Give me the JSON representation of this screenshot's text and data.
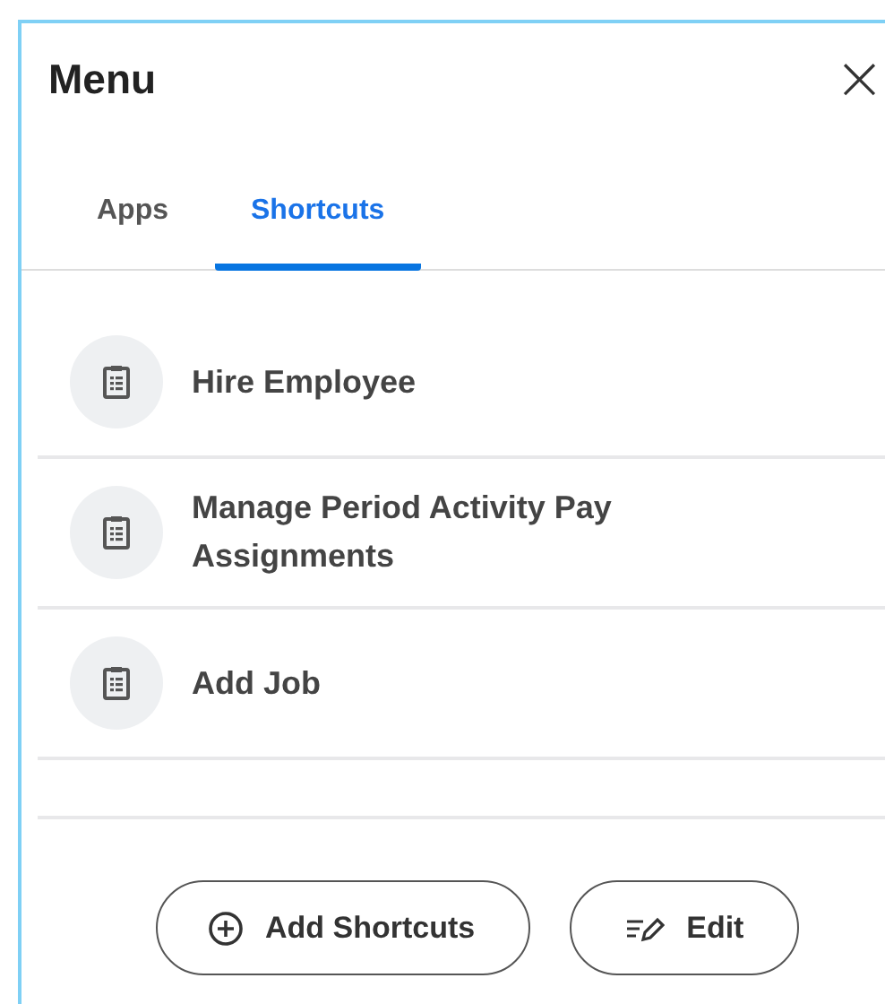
{
  "panel": {
    "title": "Menu",
    "close": "×"
  },
  "tabs": [
    {
      "label": "Apps",
      "selected": false
    },
    {
      "label": "Shortcuts",
      "selected": true
    }
  ],
  "shortcuts": [
    {
      "label": "Hire Employee"
    },
    {
      "label": "Manage Period Activity Pay Assignments"
    },
    {
      "label": "Add Job"
    }
  ],
  "buttons": [
    {
      "kind": "add",
      "label": "Add Shortcuts"
    },
    {
      "kind": "edit",
      "label": "Edit"
    }
  ]
}
